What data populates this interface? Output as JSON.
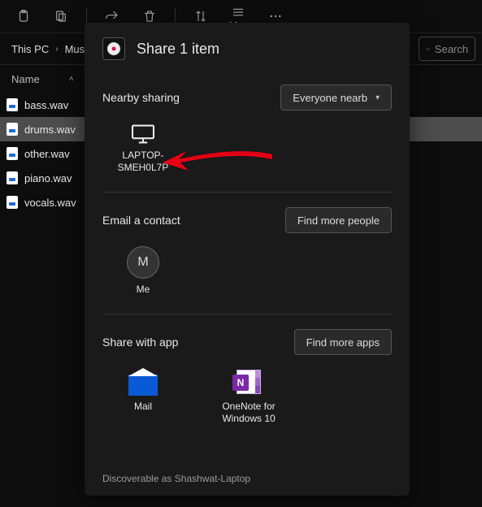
{
  "toolbar": {
    "icons": [
      "paste-icon",
      "desktop-icon",
      "share-icon",
      "delete-icon",
      "sort-icon",
      "view-icon",
      "more-icon"
    ]
  },
  "breadcrumb": {
    "items": [
      "This PC",
      "Music"
    ]
  },
  "search": {
    "placeholder": "Search"
  },
  "columns": {
    "name": "Name"
  },
  "files": [
    {
      "name": "bass.wav",
      "selected": false
    },
    {
      "name": "drums.wav",
      "selected": true
    },
    {
      "name": "other.wav",
      "selected": false
    },
    {
      "name": "piano.wav",
      "selected": false
    },
    {
      "name": "vocals.wav",
      "selected": false
    }
  ],
  "share": {
    "title": "Share 1 item",
    "nearby": {
      "label": "Nearby sharing",
      "dropdown": "Everyone nearb",
      "device": "LAPTOP-SMEH0L7P"
    },
    "email": {
      "label": "Email a contact",
      "button": "Find more people",
      "me_initial": "M",
      "me_label": "Me"
    },
    "apps": {
      "label": "Share with app",
      "button": "Find more apps",
      "items": [
        {
          "name": "Mail"
        },
        {
          "name": "OneNote for Windows 10"
        }
      ]
    },
    "footer": "Discoverable as Shashwat-Laptop"
  }
}
